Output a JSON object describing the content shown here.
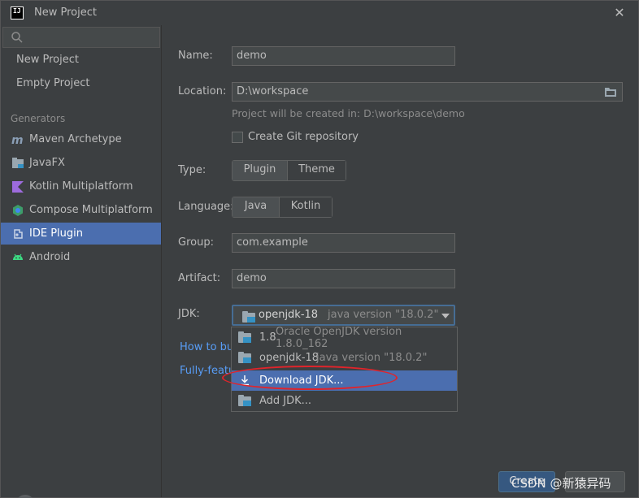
{
  "window": {
    "title": "New Project",
    "logo_text": "IJ"
  },
  "sidebar": {
    "search_placeholder": "",
    "items": [
      {
        "label": "New Project"
      },
      {
        "label": "Empty Project"
      }
    ],
    "group_label": "Generators",
    "generators": [
      {
        "label": "Maven Archetype",
        "icon": "maven-icon"
      },
      {
        "label": "JavaFX",
        "icon": "javafx-icon"
      },
      {
        "label": "Kotlin Multiplatform",
        "icon": "kotlin-icon"
      },
      {
        "label": "Compose Multiplatform",
        "icon": "compose-icon"
      },
      {
        "label": "IDE Plugin",
        "icon": "plugin-icon",
        "selected": true
      },
      {
        "label": "Android",
        "icon": "android-icon"
      }
    ]
  },
  "form": {
    "name_label": "Name:",
    "name_value": "demo",
    "location_label": "Location:",
    "location_value": "D:\\workspace",
    "location_hint": "Project will be created in: D:\\workspace\\demo",
    "git_label": "Create Git repository",
    "type_label": "Type:",
    "type_options": [
      "Plugin",
      "Theme"
    ],
    "language_label": "Language:",
    "language_options": [
      "Java",
      "Kotlin"
    ],
    "group_label": "Group:",
    "group_value": "com.example",
    "artifact_label": "Artifact:",
    "artifact_value": "demo",
    "jdk_label": "JDK:",
    "jdk_selected_name": "openjdk-18",
    "jdk_selected_version": "java version \"18.0.2\"",
    "link1": "How to bu",
    "link2": "Fully-featu"
  },
  "jdk_popup": {
    "items": [
      {
        "name": "1.8",
        "detail": "Oracle OpenJDK version 1.8.0_162"
      },
      {
        "name": "openjdk-18",
        "detail": "java version \"18.0.2\""
      },
      {
        "name": "Download JDK..."
      },
      {
        "name": "Add JDK..."
      }
    ]
  },
  "footer": {
    "help_label": "?",
    "create_label": "Create",
    "watermark": "CSDN @新猿异码"
  },
  "colors": {
    "accent": "#4b6eaf",
    "link": "#589df6",
    "annotation": "#e0242b"
  }
}
